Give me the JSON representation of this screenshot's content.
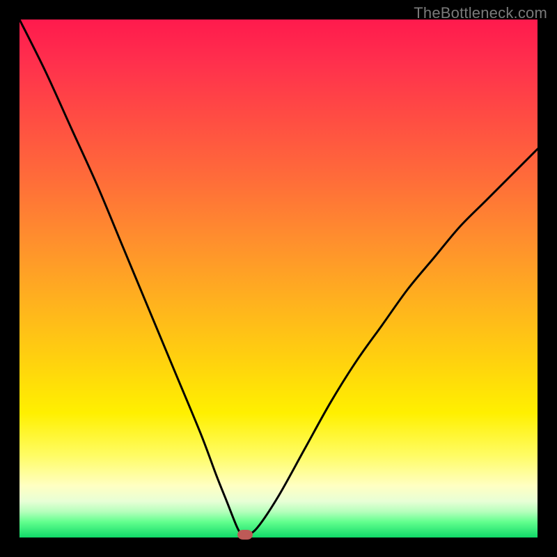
{
  "watermark": "TheBottleneck.com",
  "colors": {
    "frame": "#000000",
    "curve": "#000000",
    "marker": "#bd5a57"
  },
  "chart_data": {
    "type": "line",
    "title": "",
    "xlabel": "",
    "ylabel": "",
    "xlim": [
      0,
      100
    ],
    "ylim": [
      0,
      100
    ],
    "grid": false,
    "legend": false,
    "series": [
      {
        "name": "bottleneck-curve",
        "x": [
          0,
          5,
          10,
          15,
          20,
          25,
          30,
          35,
          38,
          40,
          42,
          43,
          44,
          46,
          50,
          55,
          60,
          65,
          70,
          75,
          80,
          85,
          90,
          95,
          100
        ],
        "y": [
          100,
          90,
          79,
          68,
          56,
          44,
          32,
          20,
          12,
          7,
          2,
          0.5,
          0.5,
          2,
          8,
          17,
          26,
          34,
          41,
          48,
          54,
          60,
          65,
          70,
          75
        ]
      }
    ],
    "marker": {
      "x": 43.5,
      "y": 0.5
    },
    "background_gradient": {
      "top_color": "#ff1a4d",
      "mid_color": "#ffd20e",
      "bottom_color": "#10d968"
    }
  }
}
